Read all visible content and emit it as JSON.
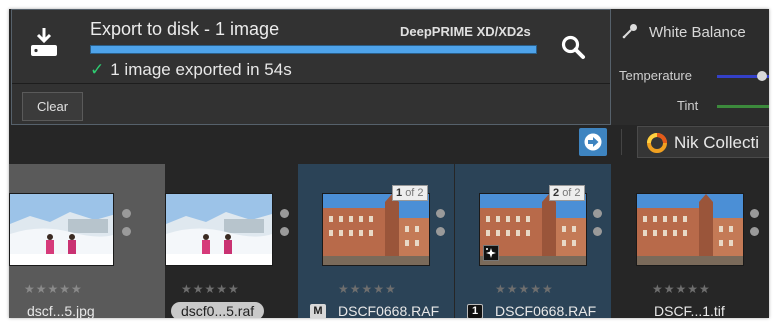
{
  "export_popup": {
    "title": "Export to disk - 1 image",
    "engine": "DeepPRIME XD/XD2s",
    "progress": 1.0,
    "status": "1 image exported in 54s",
    "clear_label": "Clear",
    "icons": {
      "export": "export-to-disk-icon",
      "search": "search-icon",
      "check": "checkmark-icon"
    }
  },
  "right_panel": {
    "title": "White Balance",
    "sliders": [
      {
        "label": "Temperature",
        "track_color": "#3440c8"
      },
      {
        "label": "Tint",
        "track_color": "#3c8a3c"
      }
    ]
  },
  "toolbar": {
    "nik_label": "Nik Collecti",
    "icons": {
      "export_go": "export-arrow-icon",
      "nik": "nik-collection-logo-icon"
    }
  },
  "thumbnails": [
    {
      "name": "dscf...5.jpg",
      "state": "unselected-grey",
      "rating": 0,
      "scene": "snow"
    },
    {
      "name": "dscf0...5.raf",
      "state": "unselected",
      "rating": 0,
      "scene": "snow"
    },
    {
      "name": "DSCF0668.RAF",
      "state": "selected",
      "rating": 0,
      "scene": "building",
      "badge_num": "1",
      "badge_of": "of 2",
      "mini_badge": "M"
    },
    {
      "name": "DSCF0668.RAF",
      "state": "selected",
      "rating": 0,
      "scene": "building",
      "badge_num": "2",
      "badge_of": "of 2",
      "mini_badge": "1",
      "has_correction_icon": true
    },
    {
      "name": "DSCF...1.tif",
      "state": "unselected",
      "rating": 0,
      "scene": "building"
    }
  ],
  "colors": {
    "accent": "#4ea3ea",
    "selected_bg": "#2b4357",
    "success": "#2ecc71"
  }
}
